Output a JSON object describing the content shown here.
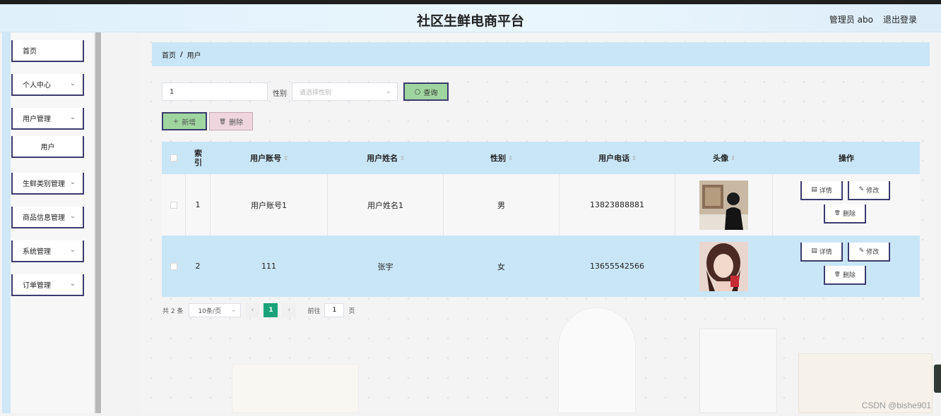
{
  "header": {
    "title": "社区生鲜电商平台",
    "admin": "管理员 abo",
    "logout": "退出登录"
  },
  "sidebar": {
    "items": [
      {
        "label": "首页",
        "has_chevron": false
      },
      {
        "label": "个人中心",
        "has_chevron": true
      },
      {
        "label": "用户管理",
        "has_chevron": true
      },
      {
        "label": "用户",
        "has_chevron": false,
        "sub": true
      },
      {
        "label": "生鲜类别管理",
        "has_chevron": true
      },
      {
        "label": "商品信息管理",
        "has_chevron": true
      },
      {
        "label": "系统管理",
        "has_chevron": true
      },
      {
        "label": "订单管理",
        "has_chevron": true
      }
    ],
    "chevron_icon": "chevron-down-icon"
  },
  "breadcrumb": {
    "home": "首页",
    "separator": "/",
    "current": "用户"
  },
  "search": {
    "keyword_value": "1",
    "gender_label": "性别",
    "gender_placeholder": "请选择性别",
    "search_icon": "○",
    "search_label": "查询"
  },
  "actions": {
    "add_icon": "+",
    "add_label": "新增",
    "delete_icon": "🗑",
    "delete_label": "删除"
  },
  "table": {
    "columns": [
      "索引",
      "用户账号",
      "用户姓名",
      "性别",
      "用户电话",
      "头像",
      "操作"
    ],
    "sort_glyph": "⇕",
    "rows": [
      {
        "index": "1",
        "account": "用户账号1",
        "name": "用户姓名1",
        "gender": "男",
        "phone": "13823888881",
        "avatar": "avatar-photo"
      },
      {
        "index": "2",
        "account": "111",
        "name": "张宇",
        "gender": "女",
        "phone": "13655542566",
        "avatar": "avatar-photo"
      }
    ],
    "ops": {
      "detail": "详情",
      "edit": "修改",
      "delete": "删除"
    },
    "op_icons": {
      "detail": "▤",
      "edit": "✎",
      "delete": "🗑"
    }
  },
  "pagination": {
    "total": "共 2 条",
    "page_size": "10条/页",
    "current_page": "1",
    "goto_label": "前往",
    "goto_value": "1",
    "page_unit": "页"
  },
  "watermark": "CSDN @bishe901",
  "colors": {
    "accent_blue": "#c9e6f6",
    "button_green": "#9fd69f",
    "page_active": "#1aa37a",
    "border_navy": "#3c3b6e"
  }
}
